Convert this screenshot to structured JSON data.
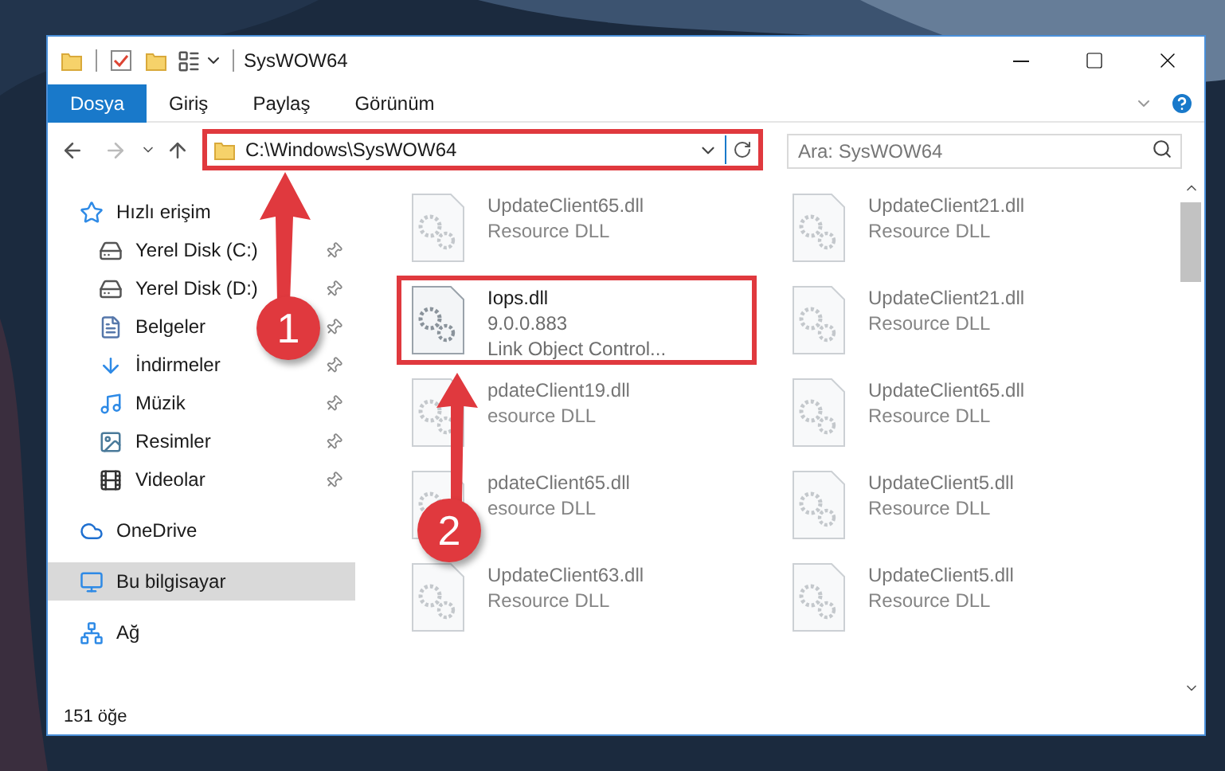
{
  "window": {
    "title": "SysWOW64"
  },
  "ribbon_tabs": [
    {
      "label": "Dosya",
      "selected": true
    },
    {
      "label": "Giriş",
      "selected": false
    },
    {
      "label": "Paylaş",
      "selected": false
    },
    {
      "label": "Görünüm",
      "selected": false
    }
  ],
  "address": {
    "path": "C:\\Windows\\SysWOW64",
    "highlighted": true
  },
  "search": {
    "placeholder": "Ara: SysWOW64"
  },
  "sidebar": {
    "items": [
      {
        "label": "Hızlı erişim",
        "kind": "star",
        "pinned": false,
        "selected": false
      },
      {
        "label": "Yerel Disk (C:)",
        "kind": "drive",
        "pinned": true,
        "selected": false
      },
      {
        "label": "Yerel Disk (D:)",
        "kind": "drive",
        "pinned": true,
        "selected": false
      },
      {
        "label": "Belgeler",
        "kind": "documents",
        "pinned": true,
        "selected": false
      },
      {
        "label": "İndirmeler",
        "kind": "downloads",
        "pinned": true,
        "selected": false
      },
      {
        "label": "Müzik",
        "kind": "music",
        "pinned": true,
        "selected": false
      },
      {
        "label": "Resimler",
        "kind": "pictures",
        "pinned": true,
        "selected": false
      },
      {
        "label": "Videolar",
        "kind": "videos",
        "pinned": true,
        "selected": false
      },
      {
        "label": "OneDrive",
        "kind": "cloud",
        "pinned": false,
        "selected": false
      },
      {
        "label": "Bu bilgisayar",
        "kind": "computer",
        "pinned": false,
        "selected": true
      },
      {
        "label": "Ağ",
        "kind": "network",
        "pinned": false,
        "selected": false
      }
    ]
  },
  "files": [
    {
      "name": "UpdateClient65.dll",
      "details": [
        "Resource DLL"
      ],
      "blurred": true,
      "highlighted": false
    },
    {
      "name": "UpdateClient21.dll",
      "details": [
        "Resource DLL"
      ],
      "blurred": true,
      "highlighted": false
    },
    {
      "name": "Iops.dll",
      "details": [
        "9.0.0.883",
        "Link Object Control..."
      ],
      "blurred": false,
      "highlighted": true
    },
    {
      "name": "UpdateClient21.dll",
      "details": [
        "Resource DLL"
      ],
      "blurred": true,
      "highlighted": false
    },
    {
      "name": "pdateClient19.dll",
      "details": [
        "esource DLL"
      ],
      "blurred": true,
      "highlighted": false
    },
    {
      "name": "UpdateClient65.dll",
      "details": [
        "Resource DLL"
      ],
      "blurred": true,
      "highlighted": false
    },
    {
      "name": "pdateClient65.dll",
      "details": [
        "esource DLL"
      ],
      "blurred": true,
      "highlighted": false
    },
    {
      "name": "UpdateClient5.dll",
      "details": [
        "Resource DLL"
      ],
      "blurred": true,
      "highlighted": false
    },
    {
      "name": "UpdateClient63.dll",
      "details": [
        "Resource DLL"
      ],
      "blurred": true,
      "highlighted": false
    },
    {
      "name": "UpdateClient5.dll",
      "details": [
        "Resource DLL"
      ],
      "blurred": true,
      "highlighted": false
    }
  ],
  "status_bar": {
    "count": "151 öğe"
  },
  "callouts": [
    {
      "number": "1"
    },
    {
      "number": "2"
    }
  ]
}
